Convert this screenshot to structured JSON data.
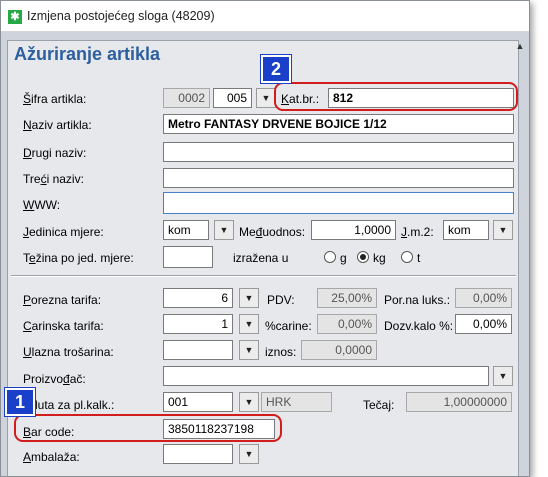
{
  "window": {
    "title": "Izmjena postojećeg sloga (48209)"
  },
  "panel": {
    "title": "Ažuriranje artikla"
  },
  "fields": {
    "sifra_label": "Šifra artikla:",
    "sifra1": "0002",
    "sifra2": "005",
    "katbr_label": "Kat.br.:",
    "katbr": "812",
    "naziv_label": "Naziv artikla:",
    "naziv": "Metro FANTASY DRVENE BOJICE 1/12",
    "drugi_label": "Drugi naziv:",
    "drugi": "",
    "treci_label": "Treći naziv:",
    "treci": "",
    "www_label": "WWW:",
    "www": "",
    "jm_label": "Jedinica mjere:",
    "jm": "kom",
    "medu_label": "Međuodnos:",
    "medu": "1,0000",
    "jm2_label": "J.m.2:",
    "jm2": "kom",
    "tezina_label": "Težina po jed. mjere:",
    "tezina": "",
    "izrazena_label": "izražena u",
    "unit_g": "g",
    "unit_kg": "kg",
    "unit_t": "t",
    "porezna_label": "Porezna tarifa:",
    "porezna": "6",
    "pdv_label": "PDV:",
    "pdv": "25,00%",
    "porluks_label": "Por.na luks.:",
    "porluks": "0,00%",
    "carinska_label": "Carinska tarifa:",
    "carinska": "1",
    "carine_label": "%carine:",
    "carine": "0,00%",
    "dozv_label": "Dozv.kalo %:",
    "dozv": "0,00%",
    "ulazna_label": "Ulazna trošarina:",
    "ulazna": "",
    "iznos_label": "iznos:",
    "iznos": "0,0000",
    "proizv_label": "Proizvođač:",
    "proizv": "",
    "valuta_label": "luta za pl.kalk.:",
    "valuta": "001",
    "valuta_name": "HRK",
    "tecaj_label": "Tečaj:",
    "tecaj": "1,00000000",
    "barcode_label": "Bar code:",
    "barcode": "3850118237198",
    "ambalaza_label": "Ambalaža:"
  },
  "badges": {
    "one": "1",
    "two": "2"
  },
  "icons": {
    "dropdown": "▼",
    "app": "✱",
    "scroll_up": "▲"
  },
  "colors": {
    "title_blue": "#2d5f9e",
    "highlight_red": "#d31d1d",
    "badge_blue": "#1a3fc8"
  }
}
